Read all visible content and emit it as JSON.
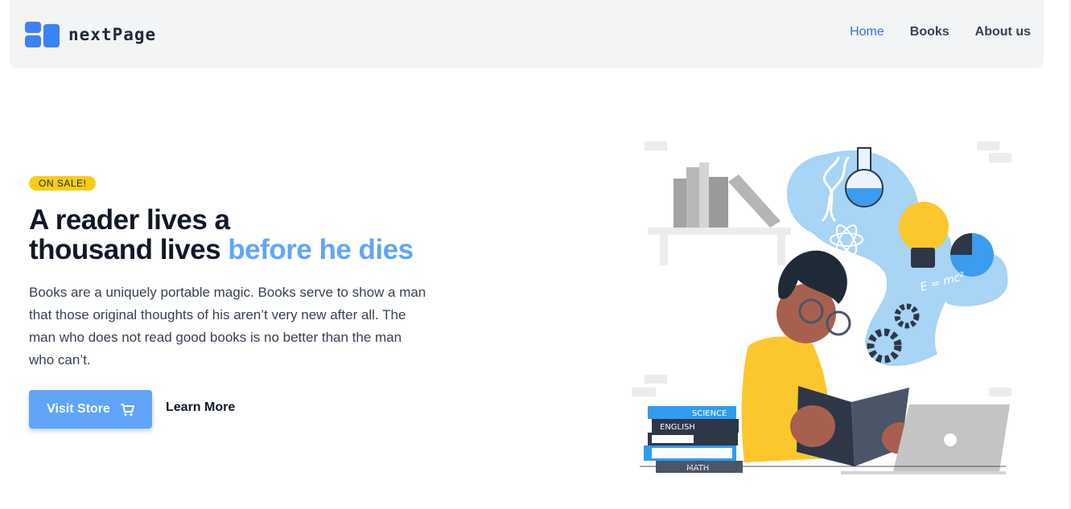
{
  "brand": {
    "name": "nextPage",
    "logo_icon": "blocks-logo-icon",
    "color": "#3b82f6"
  },
  "nav": {
    "items": [
      {
        "label": "Home",
        "active": true
      },
      {
        "label": "Books",
        "active": false
      },
      {
        "label": "About us",
        "active": false
      }
    ]
  },
  "hero": {
    "badge": "ON SALE!",
    "headline_line1": "A reader lives a",
    "headline_line2": "thousand lives",
    "headline_accent": "before he dies",
    "description": "Books are a uniquely portable magic. Books serve to show a man that those original thoughts of his aren’t very new after all. The man who does not read good books is no better than the man who can’t.",
    "primary_button": {
      "label": "Visit Store",
      "icon": "cart-icon"
    },
    "secondary_button": {
      "label": "Learn More"
    }
  },
  "illustration": {
    "book_labels": [
      "SCIENCE",
      "ENGLISH",
      "MATH"
    ],
    "formula": "E = mc²"
  },
  "colors": {
    "accent": "#60a5fa",
    "badge": "#facc15",
    "nav_active": "#3b6fd6",
    "navbar_bg": "#f3f4f6"
  }
}
